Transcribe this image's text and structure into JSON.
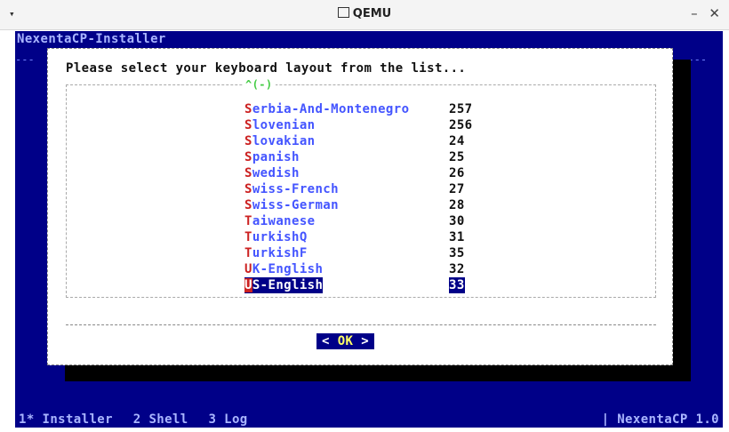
{
  "window": {
    "title": "QEMU",
    "menu_glyph": "▾",
    "minimize_glyph": "–",
    "close_glyph": "✕"
  },
  "screen": {
    "header": "NexentaCP-Installer",
    "bg_color": "#000088"
  },
  "dialog": {
    "prompt": "Please select your keyboard layout from the list...",
    "scroll_indicator": "^(-)",
    "items": [
      {
        "hot": "S",
        "rest": "erbia-And-Montenegro",
        "code": "257"
      },
      {
        "hot": "S",
        "rest": "lovenian",
        "code": "256"
      },
      {
        "hot": "S",
        "rest": "lovakian",
        "code": "24"
      },
      {
        "hot": "S",
        "rest": "panish",
        "code": "25"
      },
      {
        "hot": "S",
        "rest": "wedish",
        "code": "26"
      },
      {
        "hot": "S",
        "rest": "wiss-French",
        "code": "27"
      },
      {
        "hot": "S",
        "rest": "wiss-German",
        "code": "28"
      },
      {
        "hot": "T",
        "rest": "aiwanese",
        "code": "30"
      },
      {
        "hot": "T",
        "rest": "urkishQ",
        "code": "31"
      },
      {
        "hot": "T",
        "rest": "urkishF",
        "code": "35"
      },
      {
        "hot": "U",
        "rest": "K-English",
        "code": "32"
      },
      {
        "hot": "U",
        "rest": "S-English",
        "code": "33",
        "selected": true
      }
    ],
    "ok_button": {
      "left": "<",
      "label": "OK",
      "right": ">"
    }
  },
  "statusbar": {
    "items": [
      "1* Installer",
      "2 Shell",
      "3 Log"
    ],
    "right": "| NexentaCP 1.0"
  }
}
